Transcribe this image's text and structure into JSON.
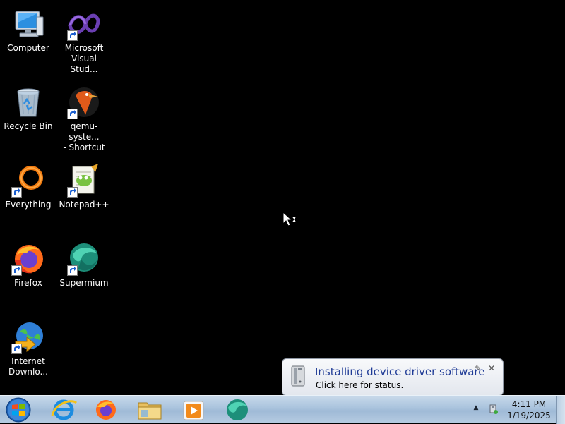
{
  "desktop": {
    "icons": [
      {
        "label": "Computer",
        "icon": "computer-icon"
      },
      {
        "label": "Microsoft\nVisual Stud...",
        "icon": "visual-studio-icon"
      },
      {
        "label": "Recycle Bin",
        "icon": "recycle-bin-icon"
      },
      {
        "label": "qemu-syste...\n- Shortcut",
        "icon": "qemu-icon"
      },
      {
        "label": "Everything",
        "icon": "everything-icon"
      },
      {
        "label": "Notepad++",
        "icon": "notepadpp-icon"
      },
      {
        "label": "Firefox",
        "icon": "firefox-icon"
      },
      {
        "label": "Supermium",
        "icon": "supermium-icon"
      },
      {
        "label": "Internet\nDownlo...",
        "icon": "internet-download-manager-icon"
      }
    ]
  },
  "balloon": {
    "title": "Installing device driver software",
    "text": "Click here for status.",
    "close_glyph": "✕",
    "pin_glyph": "✎"
  },
  "taskbar": {
    "pinned": [
      {
        "name": "internet-explorer-button"
      },
      {
        "name": "firefox-button"
      },
      {
        "name": "file-explorer-button"
      },
      {
        "name": "media-player-button"
      },
      {
        "name": "supermium-button"
      }
    ],
    "tray_arrow": "▲",
    "clock_time": "4:11 PM",
    "clock_date": "1/19/2025"
  },
  "colors": {
    "desktop_bg": "#000000",
    "taskbar_top": "#c8d9ea",
    "balloon_title": "#1f3b96"
  }
}
